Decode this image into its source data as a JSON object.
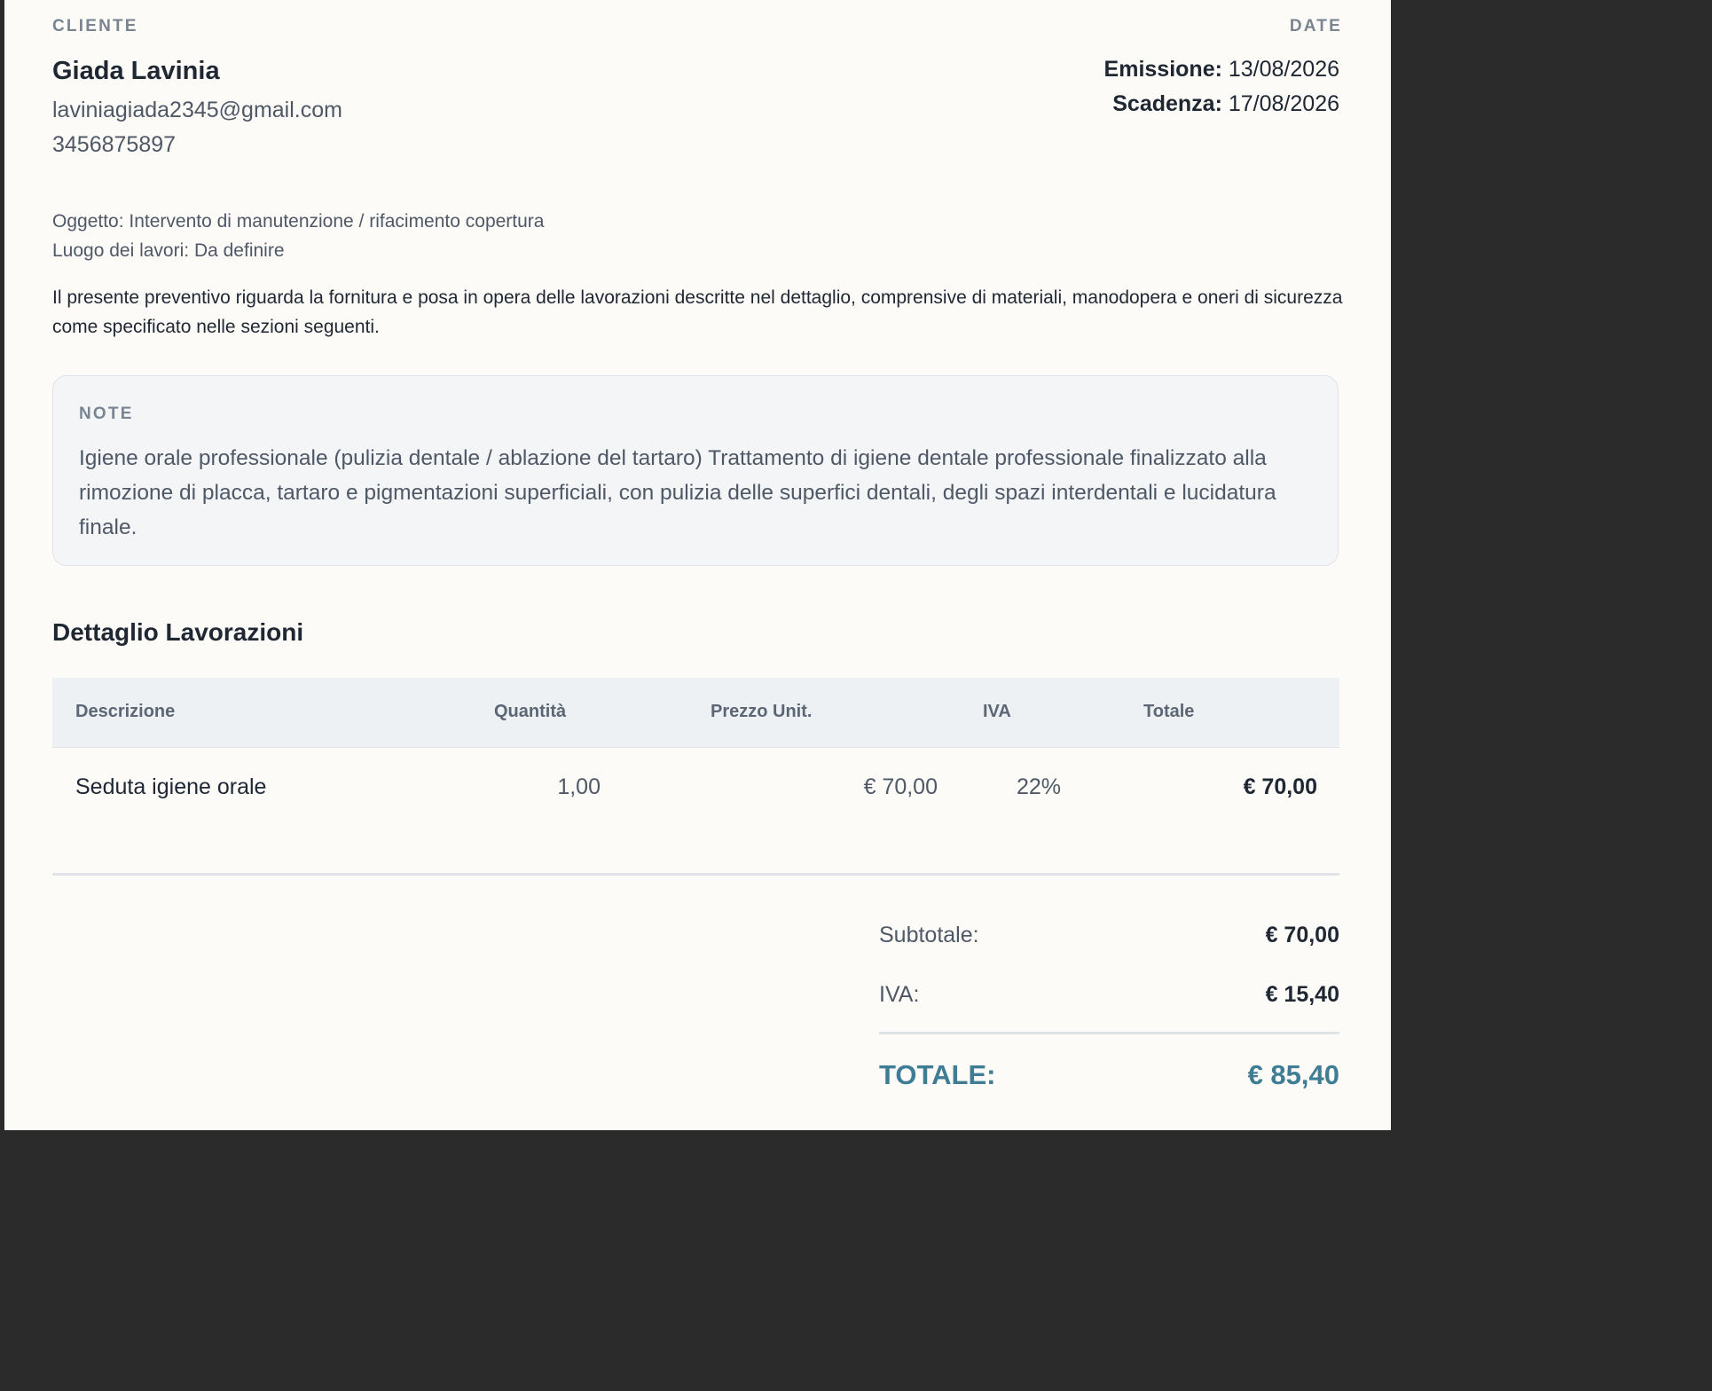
{
  "client": {
    "section_label": "CLIENTE",
    "name": "Giada Lavinia",
    "email": "laviniagiada2345@gmail.com",
    "phone": "3456875897"
  },
  "dates": {
    "section_label": "DATE",
    "issue_label": "Emissione:",
    "issue_value": "13/08/2026",
    "due_label": "Scadenza:",
    "due_value": "17/08/2026"
  },
  "subject": {
    "oggetto": "Oggetto: Intervento di manutenzione / rifacimento copertura",
    "luogo": "Luogo dei lavori: Da definire"
  },
  "intro": "Il presente preventivo riguarda la fornitura e posa in opera delle lavorazioni descritte nel dettaglio, comprensive di materiali, manodopera e oneri di sicurezza come specificato nelle sezioni seguenti.",
  "note": {
    "label": "NOTE",
    "text": "Igiene orale professionale (pulizia dentale / ablazione del tartaro) Trattamento di igiene dentale professionale finalizzato alla rimozione di placca, tartaro e pigmentazioni superficiali, con pulizia delle superfici dentali, degli spazi interdentali e lucidatura finale."
  },
  "details": {
    "title": "Dettaglio Lavorazioni",
    "columns": [
      "Descrizione",
      "Quantità",
      "Prezzo Unit.",
      "IVA",
      "Totale"
    ],
    "rows": [
      {
        "descrizione": "Seduta igiene orale",
        "quantita": "1,00",
        "prezzo": "€ 70,00",
        "iva": "22%",
        "totale": "€ 70,00"
      }
    ]
  },
  "summary": {
    "subtotal_label": "Subtotale:",
    "subtotal_value": "€ 70,00",
    "vat_label": "IVA:",
    "vat_value": "€ 15,40",
    "total_label": "TOTALE:",
    "total_value": "€ 85,40"
  },
  "colors": {
    "accent": "#3e7d93",
    "page_background": "#fcfbf8",
    "note_background": "#f3f5f7"
  }
}
